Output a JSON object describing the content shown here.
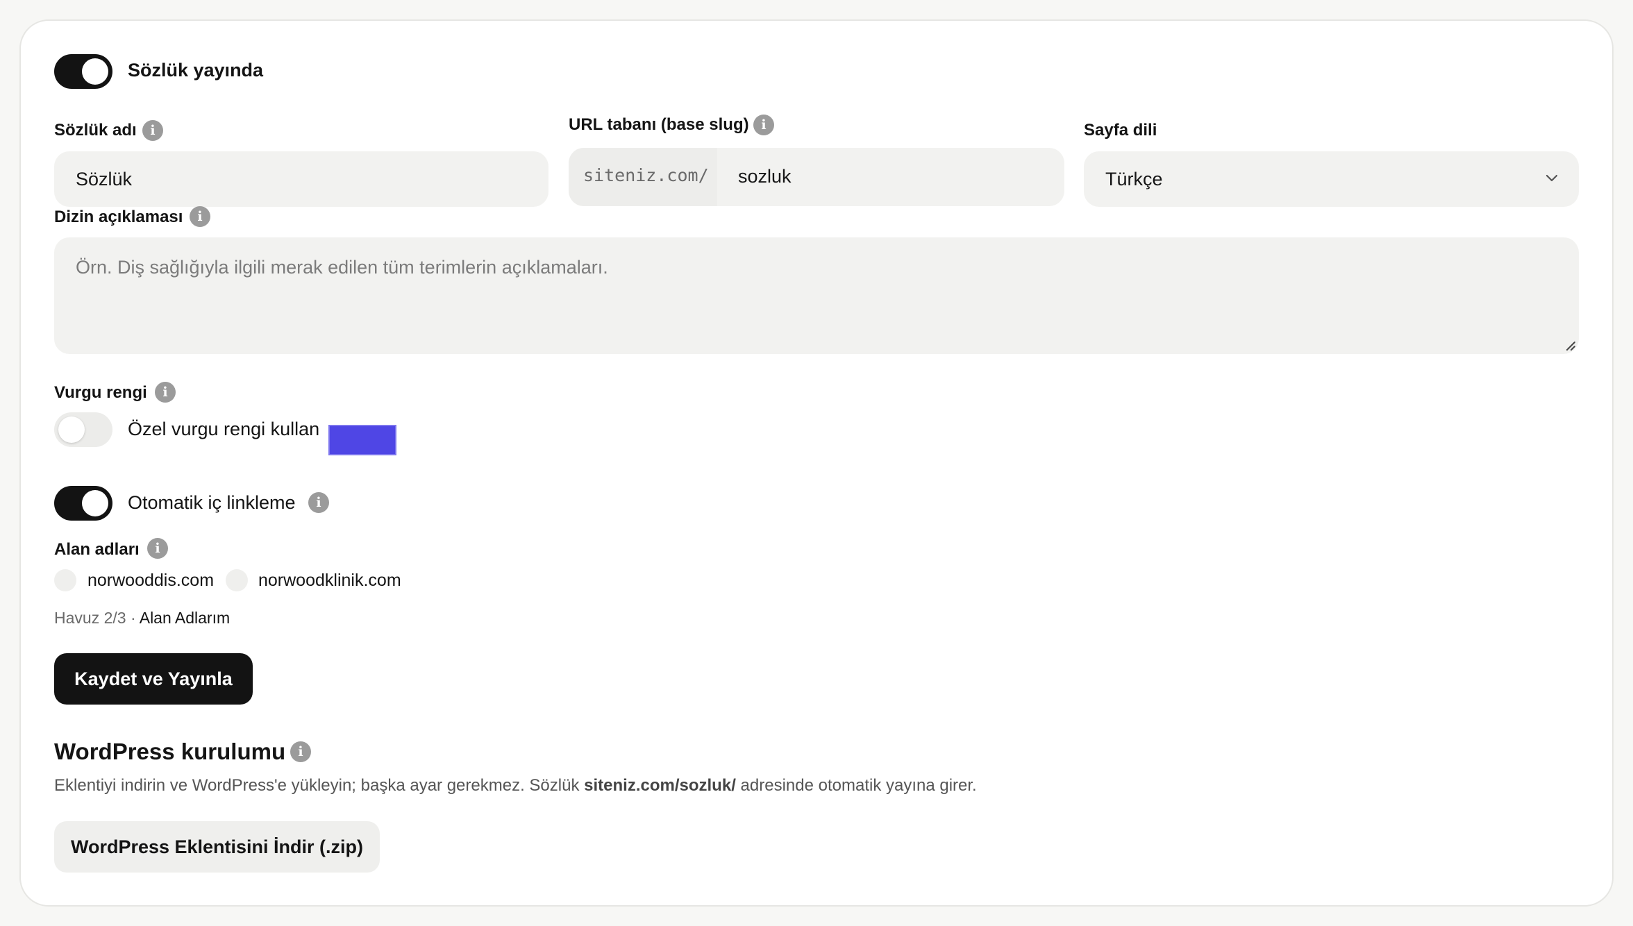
{
  "colors": {
    "accent_swatch": "#4f46e5",
    "toggle_on": "#131313",
    "field_bg": "#f2f2f0"
  },
  "publish": {
    "label": "Sözlük yayında",
    "enabled": true
  },
  "fields": {
    "name": {
      "label": "Sözlük adı",
      "value": "Sözlük",
      "info_icon": "info-icon"
    },
    "slug": {
      "label": "URL tabanı (base slug)",
      "prefix": "siteniz.com/",
      "value": "sozluk",
      "info_icon": "info-icon"
    },
    "language": {
      "label": "Sayfa dili",
      "value": "Türkçe",
      "icon": "chevron-down-icon"
    },
    "description": {
      "label": "Dizin açıklaması",
      "placeholder": "Örn. Diş sağlığıyla ilgili merak edilen tüm terimlerin açıklamaları.",
      "value": ""
    }
  },
  "accent": {
    "label": "Vurgu rengi",
    "toggle_label": "Özel vurgu rengi kullan",
    "enabled": false,
    "color": "#4f46e5"
  },
  "auto_link": {
    "label": "Otomatik iç linkleme",
    "enabled": true
  },
  "domains": {
    "label": "Alan adları",
    "items": [
      {
        "name": "norwooddis.com",
        "checked": false
      },
      {
        "name": "norwoodklinik.com",
        "checked": false
      }
    ],
    "pool_text": "Havuz 2/3 ·",
    "pool_link": "Alan Adlarım"
  },
  "save_button": "Kaydet ve Yayınla",
  "wordpress": {
    "title": "WordPress kurulumu",
    "desc_before": "Eklentiyi indirin ve WordPress'e yükleyin; başka ayar gerekmez. Sözlük",
    "desc_bold": "siteniz.com/sozluk/",
    "desc_after": "adresinde otomatik yayına girer.",
    "download_button": "WordPress Eklentisini İndir (.zip)"
  }
}
